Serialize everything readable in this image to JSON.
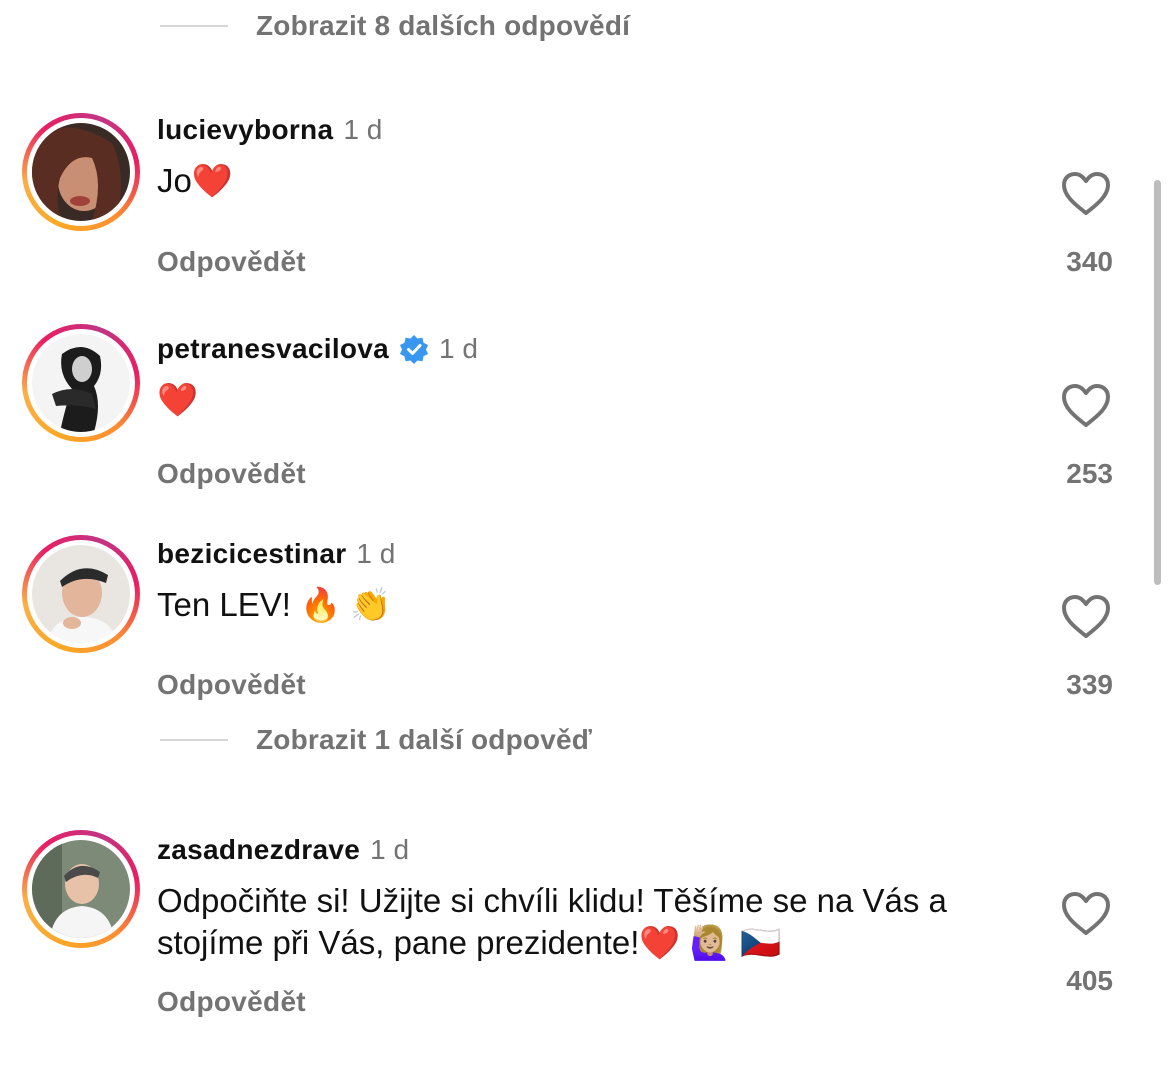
{
  "view_more_top": {
    "label": "Zobrazit 8 dalších odpovědí"
  },
  "view_more_mid": {
    "label": "Zobrazit 1 další odpověď"
  },
  "comments": [
    {
      "username": "lucievyborna",
      "time": "1 d",
      "text": "Jo❤️",
      "reply": "Odpovědět",
      "likes": "340",
      "verified": false
    },
    {
      "username": "petranesvacilova",
      "time": "1 d",
      "text": "❤️",
      "reply": "Odpovědět",
      "likes": "253",
      "verified": true
    },
    {
      "username": "bezicicestinar",
      "time": "1 d",
      "text": "Ten LEV!  🔥 👏",
      "reply": "Odpovědět",
      "likes": "339",
      "verified": false
    },
    {
      "username": "zasadnezdrave",
      "time": "1 d",
      "text": "Odpočiňte si! Užijte si chvíli klidu! Těšíme se na Vás a stojíme při Vás, pane prezidente!❤️ 🙋🏼‍♀️ 🇨🇿",
      "reply": "Odpovědět",
      "likes": "405",
      "verified": false
    }
  ],
  "colors": {
    "secondary_text": "#737373",
    "verified_badge": "#3897f0",
    "ring_gradient": [
      "#f9a825",
      "#e91e63",
      "#c13584"
    ]
  },
  "icons": {
    "like": "heart-outline-icon",
    "verified": "verified-badge-icon"
  }
}
